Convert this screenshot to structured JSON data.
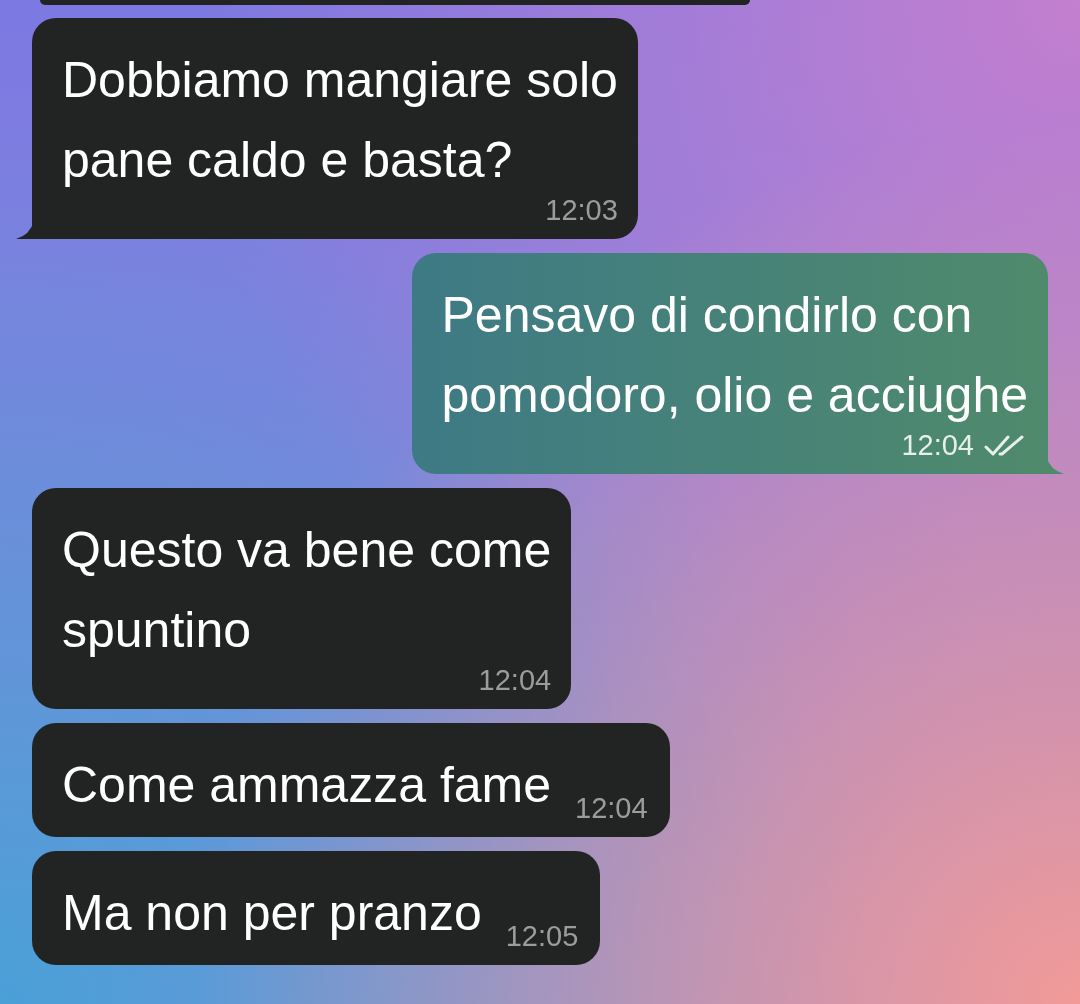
{
  "messages": [
    {
      "kind": "partial",
      "outgoing": false
    },
    {
      "kind": "text",
      "outgoing": false,
      "lines": [
        "Dobbiamo mangiare solo",
        "pane caldo e basta?"
      ],
      "time": "12:03",
      "tail": true
    },
    {
      "kind": "text",
      "outgoing": true,
      "lines": [
        "Pensavo di condirlo con",
        "pomodoro, olio e acciughe"
      ],
      "time": "12:04",
      "tail": true,
      "read": true
    },
    {
      "kind": "text",
      "outgoing": false,
      "lines": [
        "Questo va bene come",
        "spuntino"
      ],
      "time": "12:04",
      "tail": false
    },
    {
      "kind": "text",
      "outgoing": false,
      "lines": [
        "Come ammazza fame"
      ],
      "time": "12:04",
      "tail": false
    },
    {
      "kind": "text",
      "outgoing": false,
      "lines": [
        "Ma non per pranzo"
      ],
      "time": "12:05",
      "tail": false
    }
  ]
}
